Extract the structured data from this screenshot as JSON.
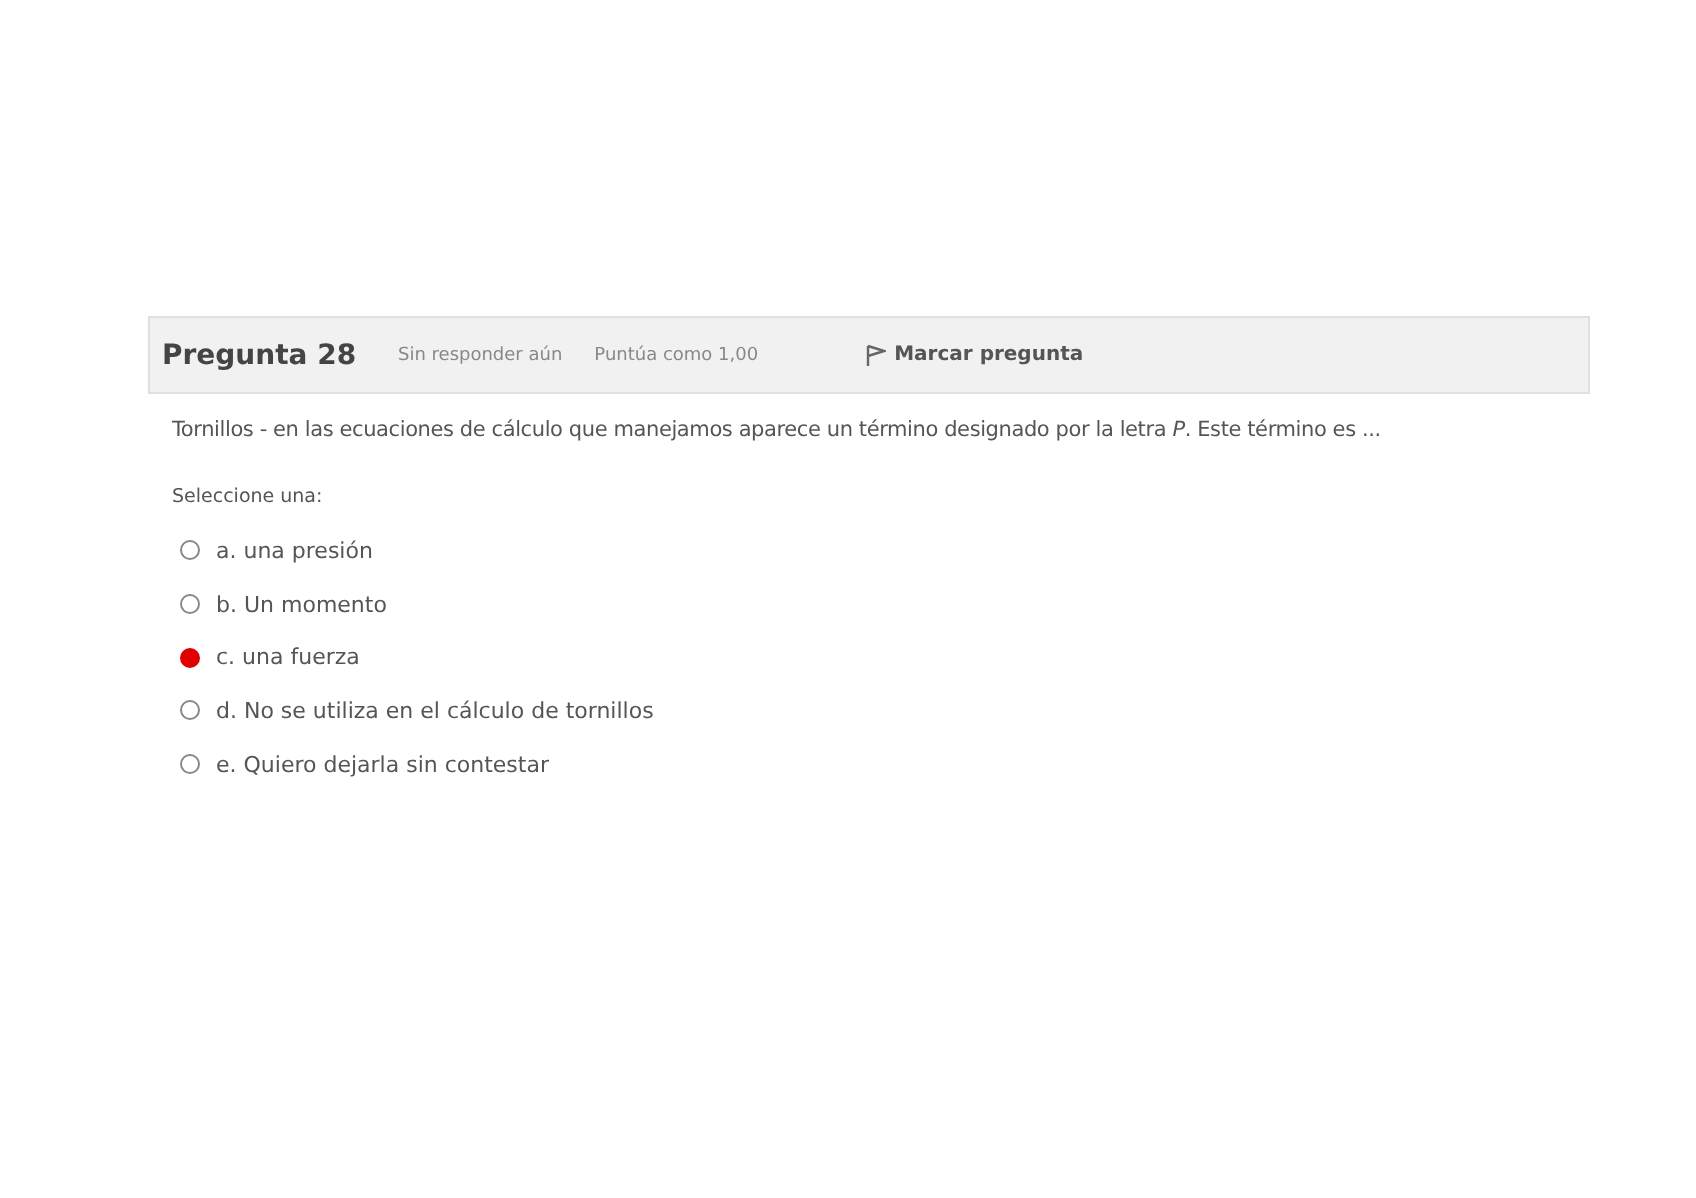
{
  "question": {
    "title": "Pregunta 28",
    "status": "Sin responder aún",
    "grade": "Puntúa como 1,00",
    "flag_label": "Marcar pregunta"
  },
  "text": "Tornillos - en las ecuaciones de cálculo que manejamos aparece un término designado por la letra *P*. Este término es ...",
  "prompt": "Seleccione una:",
  "options": [
    {
      "label": "a. una presión",
      "selected": false
    },
    {
      "label": "b. Un momento",
      "selected": false
    },
    {
      "label": "c. una fuerza",
      "selected": true
    },
    {
      "label": "d. No se utiliza en el cálculo de tornillos",
      "selected": false
    },
    {
      "label": "e. Quiero dejarla sin contestar",
      "selected": false
    }
  ]
}
